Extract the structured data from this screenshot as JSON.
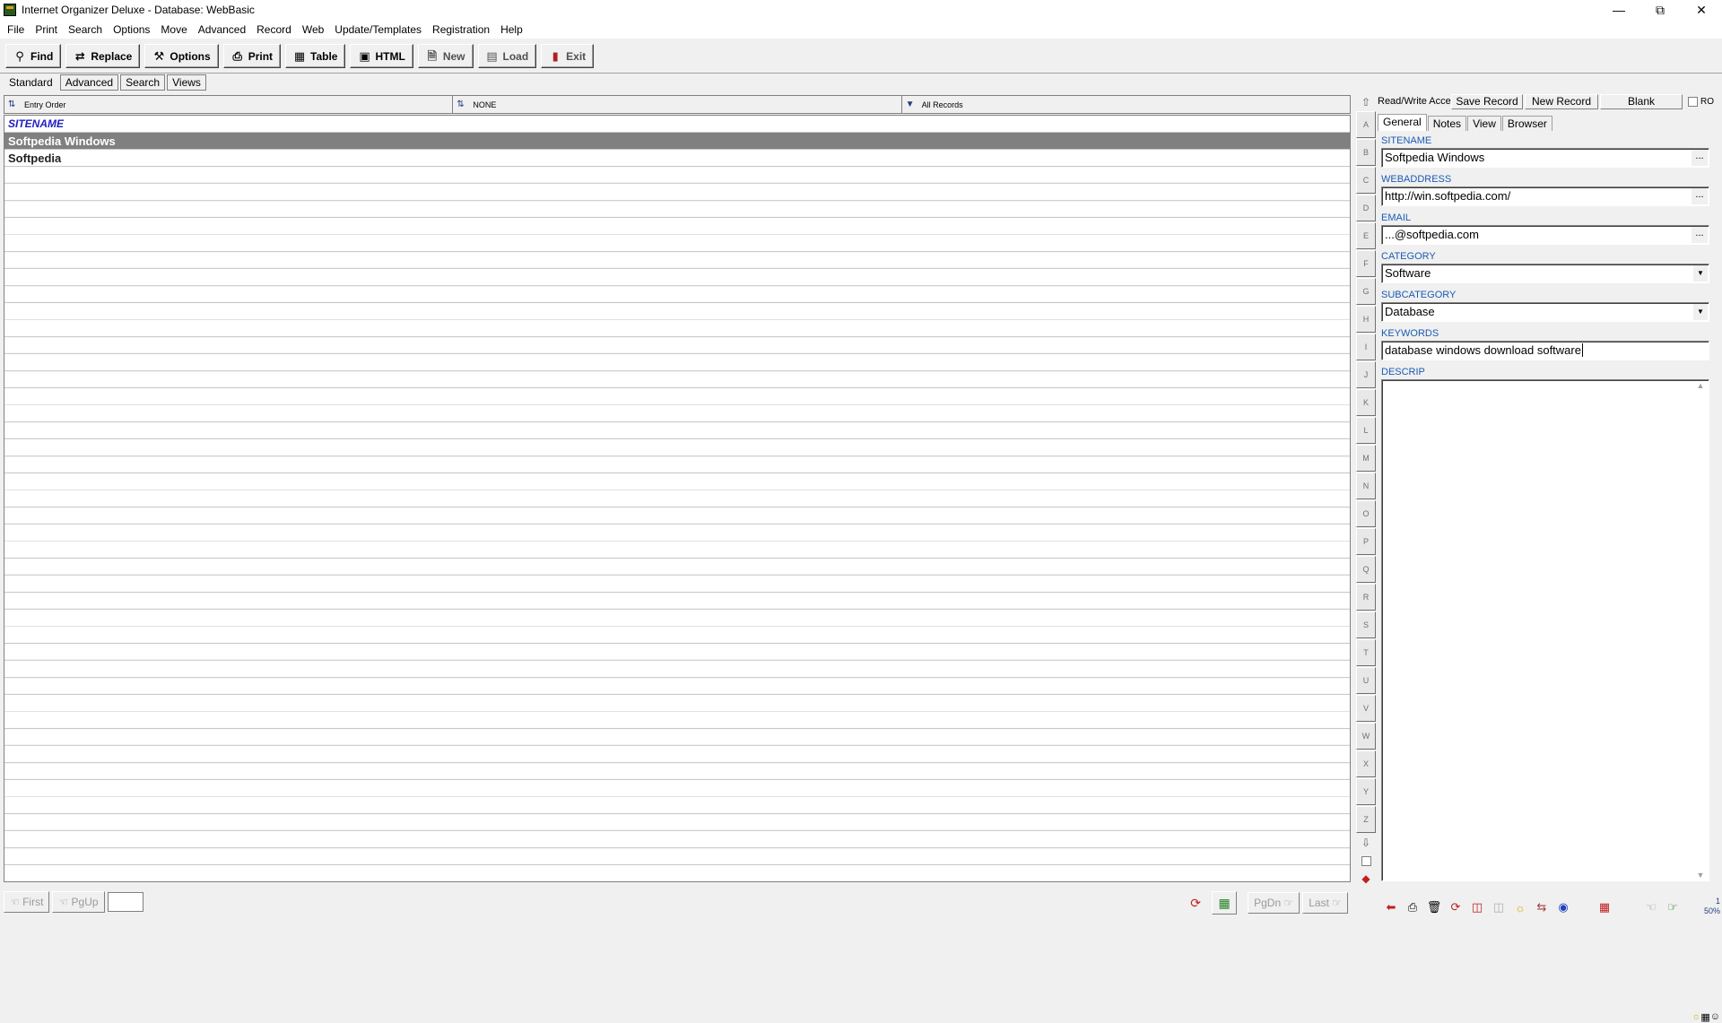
{
  "window": {
    "title": "Internet Organizer Deluxe - Database: WebBasic"
  },
  "menu": [
    "File",
    "Print",
    "Search",
    "Options",
    "Move",
    "Advanced",
    "Record",
    "Web",
    "Update/Templates",
    "Registration",
    "Help"
  ],
  "toolbar": {
    "find": "Find",
    "replace": "Replace",
    "options": "Options",
    "print": "Print",
    "table": "Table",
    "html": "HTML",
    "new": "New",
    "load": "Load",
    "exit": "Exit"
  },
  "modetabs": [
    "Standard",
    "Advanced",
    "Search",
    "Views"
  ],
  "list_header": {
    "order": "Entry Order",
    "filter": "NONE",
    "records": "All Records"
  },
  "list": {
    "column": "SITENAME",
    "rows": [
      "Softpedia Windows",
      "Softpedia"
    ]
  },
  "alphabet": [
    "A",
    "B",
    "C",
    "D",
    "E",
    "F",
    "G",
    "H",
    "I",
    "J",
    "K",
    "L",
    "M",
    "N",
    "O",
    "P",
    "Q",
    "R",
    "S",
    "T",
    "U",
    "V",
    "W",
    "X",
    "Y",
    "Z"
  ],
  "nav": {
    "first": "First",
    "pgup": "PgUp",
    "pgdn": "PgDn",
    "last": "Last",
    "page_value": ""
  },
  "right_panel": {
    "access": "Read/Write Access",
    "save": "Save Record",
    "new": "New Record",
    "blank": "Blank",
    "ro": "RO",
    "tabs": [
      "General",
      "Notes",
      "View",
      "Browser"
    ],
    "fields": {
      "sitename_label": "SITENAME",
      "sitename": "Softpedia Windows",
      "webaddress_label": "WEBADDRESS",
      "webaddress": "http://win.softpedia.com/",
      "email_label": "EMAIL",
      "email": "...@softpedia.com",
      "category_label": "CATEGORY",
      "category": "Software",
      "subcategory_label": "SUBCATEGORY",
      "subcategory": "Database",
      "keywords_label": "KEYWORDS",
      "keywords": "database windows download software",
      "descrip_label": "DESCRIP",
      "descrip": ""
    },
    "zoom": "50%",
    "zoom_top": "1"
  }
}
